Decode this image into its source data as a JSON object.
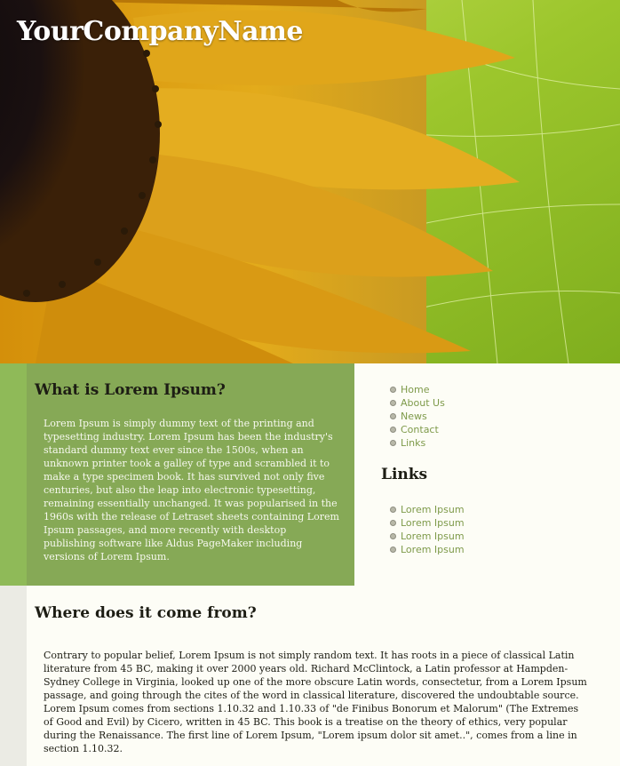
{
  "header": {
    "site_title": "YourCompanyName"
  },
  "main": {
    "section1": {
      "heading": "What is Lorem Ipsum?",
      "body": "Lorem Ipsum is simply dummy text of the printing and typesetting industry. Lorem Ipsum has been the industry's standard dummy text ever since the 1500s, when an unknown printer took a galley of type and scrambled it to make a type specimen book. It has survived not only five centuries, but also the leap into electronic typesetting, remaining essentially unchanged. It was popularised in the 1960s with the release of Letraset sheets containing Lorem Ipsum passages, and more recently with desktop publishing software like Aldus PageMaker including versions of Lorem Ipsum."
    },
    "section2": {
      "heading": "Where does it come from?",
      "body": "Contrary to popular belief, Lorem Ipsum is not simply random text. It has roots in a piece of classical Latin literature from 45 BC, making it over 2000 years old. Richard McClintock, a Latin professor at Hampden-Sydney College in Virginia, looked up one of the more obscure Latin words, consectetur, from a Lorem Ipsum passage, and going through the cites of the word in classical literature, discovered the undoubtable source. Lorem Ipsum comes from sections 1.10.32 and 1.10.33 of \"de Finibus Bonorum et Malorum\" (The Extremes of Good and Evil) by Cicero, written in 45 BC. This book is a treatise on the theory of ethics, very popular during the Renaissance. The first line of Lorem Ipsum, \"Lorem ipsum dolor sit amet..\", comes from a line in section 1.10.32."
    }
  },
  "sidebar": {
    "nav": [
      {
        "label": "Home"
      },
      {
        "label": "About Us"
      },
      {
        "label": "News"
      },
      {
        "label": "Contact"
      },
      {
        "label": "Links"
      }
    ],
    "links_heading": "Links",
    "links": [
      {
        "label": "Lorem Ipsum"
      },
      {
        "label": "Lorem Ipsum"
      },
      {
        "label": "Lorem Ipsum"
      },
      {
        "label": "Lorem Ipsum"
      }
    ]
  },
  "colors": {
    "green_panel": "#86a956",
    "link": "#7e9a4a",
    "page_bg": "#fdfdf6"
  }
}
